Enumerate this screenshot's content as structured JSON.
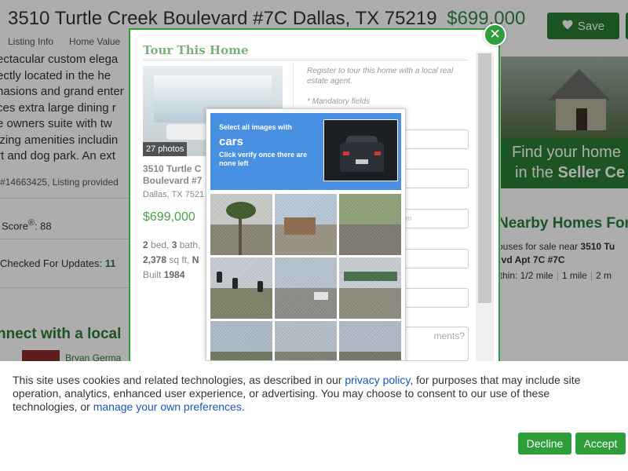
{
  "header": {
    "address": "3510 Turtle Creek Boulevard #7C Dallas, TX 75219",
    "price": "$699,000",
    "nav": [
      "Listing Info",
      "Home Value"
    ],
    "save_label": "Save"
  },
  "listing": {
    "description_lines": [
      "ectacular custom elega",
      "ectly located in the he",
      "nasions and grand enter",
      "ces extra large dining r",
      "e owners suite with tw",
      "izing amenities includin",
      "rt and dog park. An ext"
    ],
    "mls_line": "#14663425, Listing provided",
    "score_label": "Score",
    "score_sup": "®",
    "score_value": ": 88",
    "checked_label": "Checked For Updates: ",
    "checked_value": "11",
    "connect_heading": "nnect with a local",
    "agent_name": "Bryan Germa"
  },
  "sidebar": {
    "seller_line1": "Find your home",
    "seller_line2_prefix": "in the ",
    "seller_line2_bold": "Seller Ce",
    "nearby_title": "Nearby Homes For",
    "nearby_text_prefix": "ouses for sale near ",
    "nearby_text_bold": "3510 Tu",
    "nearby_text_line2": "rvd Apt 7C #7C",
    "nearby_within": "ithin: 1/2 mile",
    "nearby_1mile": "1 mile",
    "nearby_2mile": "2 m"
  },
  "modal": {
    "title": "Tour This Home",
    "close_glyph": "✕",
    "photo_count": "27 photos",
    "address_line1": "3510 Turtle C",
    "address_line2": "Boulevard #7",
    "city": "Dallas, TX 7521",
    "price": "$699,000",
    "beds_value": "2",
    "beds_label": " bed, ",
    "baths_value": "3",
    "baths_label": " bath,",
    "sqft_value": "2,378",
    "sqft_label": " sq ft, ",
    "sqft_extra": "N",
    "built_label": "Built ",
    "built_value": "1984",
    "register_text": "Register to tour this home with a local real estate agent.",
    "mandatory": "* Mandatory fields",
    "email_placeholder": "ail.com",
    "comments_placeholder": "ments?"
  },
  "captcha": {
    "instruction": "Select all images with",
    "target": "cars",
    "hint": "Click verify once there are none left"
  },
  "cookie": {
    "text_1": "This site uses cookies and related technologies, as described in our ",
    "privacy_link": "privacy policy",
    "text_2": ", for purposes that may include site operation, analytics, enhanced user experience, or advertising. You may choose to consent to our use of these technologies, or ",
    "prefs_link": "manage your own preferences",
    "text_3": ".",
    "decline_label": "Decline",
    "accept_label": "Accept"
  },
  "colors": {
    "brand_green": "#2a7d35",
    "button_green": "#2e9e3a",
    "captcha_blue": "#4a90e2",
    "link_blue": "#1a56b5"
  },
  "icons": {
    "save": "heart-icon",
    "close": "close-icon"
  }
}
